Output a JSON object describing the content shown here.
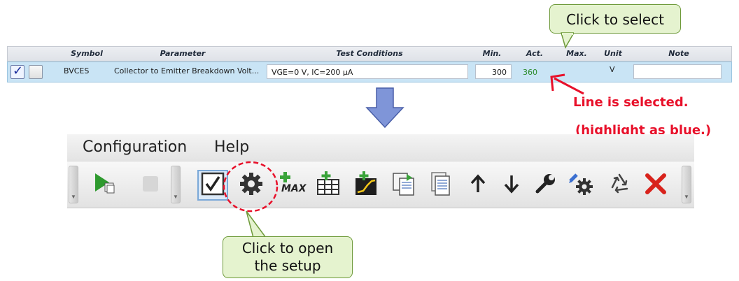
{
  "table": {
    "headers": {
      "symbol": "Symbol",
      "parameter": "Parameter",
      "test_conditions": "Test Conditions",
      "min": "Min.",
      "act": "Act.",
      "max": "Max.",
      "unit": "Unit",
      "note": "Note"
    },
    "row": {
      "enabled_checked": true,
      "symbol": "BVCES",
      "parameter": "Collector to Emitter Breakdown Volt...",
      "test_conditions": "VGE=0 V, IC=200 µA",
      "min": "300",
      "act": "360",
      "unit": "V",
      "note": ""
    }
  },
  "annotations": {
    "click_to_select": "Click to select",
    "line_selected_1": "Line is selected.",
    "line_selected_2": "(highlight as blue.)",
    "click_to_open_1": "Click to open",
    "click_to_open_2": "the setup"
  },
  "menu": {
    "configuration": "Configuration",
    "help": "Help"
  },
  "toolbar": {
    "max_label": "MAX",
    "icons": [
      "run-icon",
      "stop-icon",
      "select-checkbox-icon",
      "gear-icon",
      "add-max-icon",
      "add-table-icon",
      "add-graph-icon",
      "copy-icon",
      "paste-icon",
      "arrow-up-icon",
      "arrow-down-icon",
      "wrench-icon",
      "edit-settings-icon",
      "recycle-icon",
      "delete-icon"
    ]
  },
  "colors": {
    "selection_blue": "#c9e4f5",
    "annotation_red": "#e8102a",
    "callout_green": "#e5f3cf",
    "arrow_blue": "#7f95d8"
  }
}
